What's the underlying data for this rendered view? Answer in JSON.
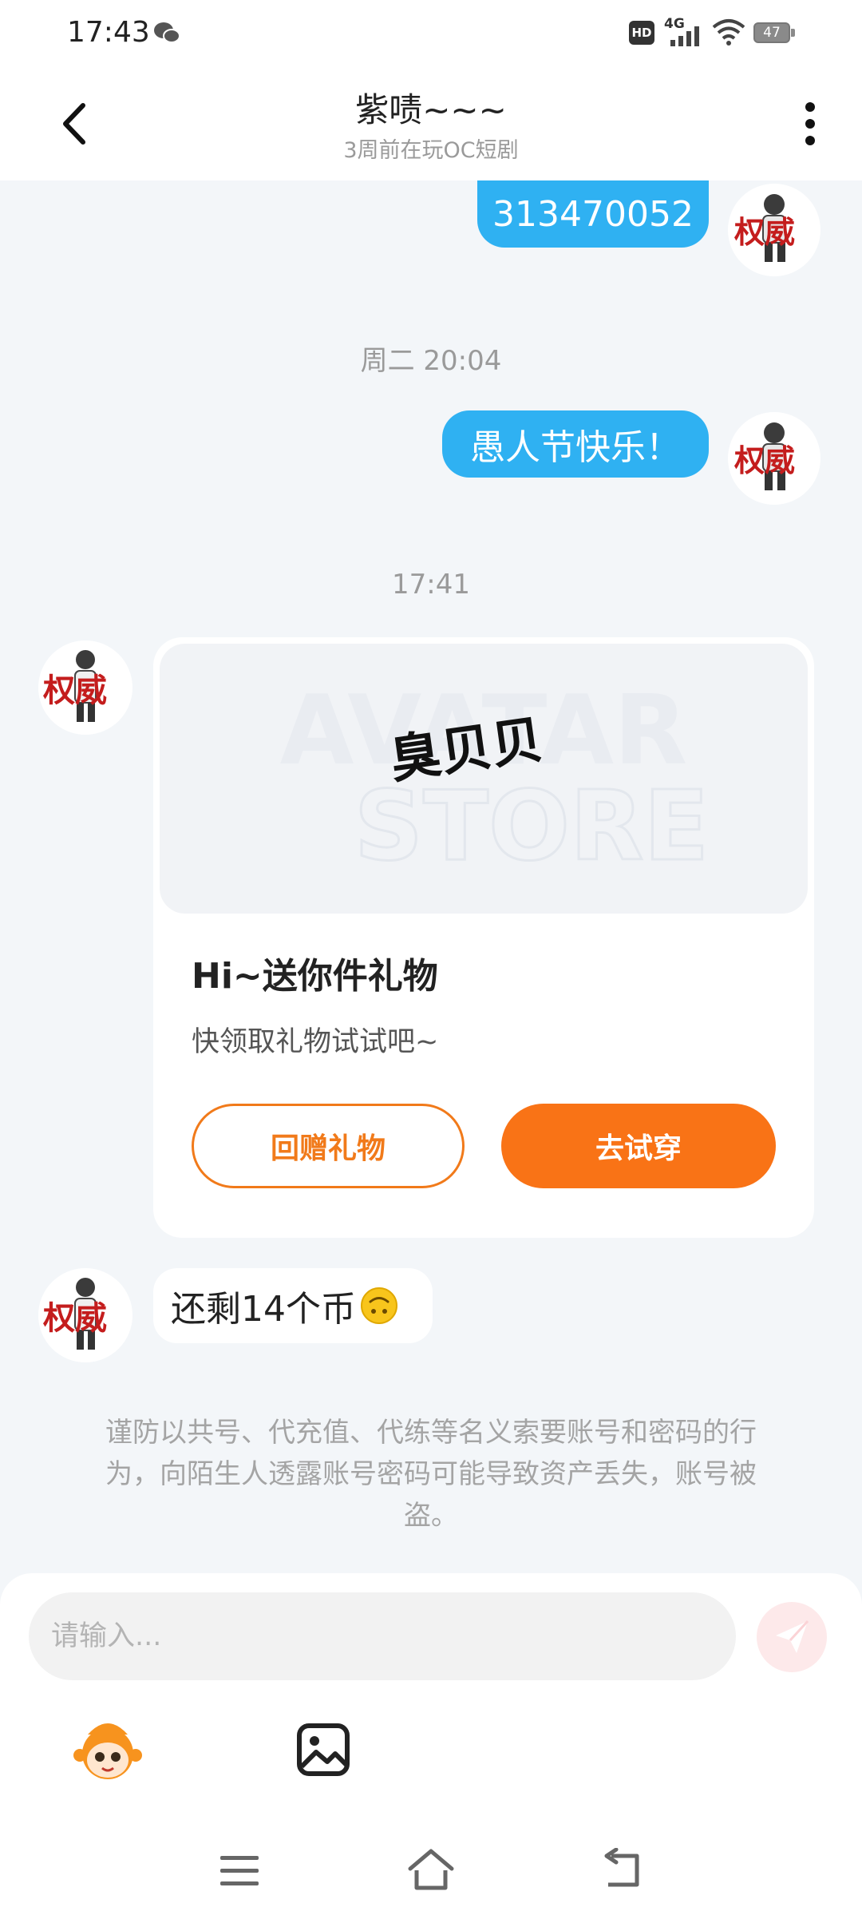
{
  "status_bar": {
    "time": "17:43",
    "hd_label": "HD",
    "network_label": "4G",
    "battery_level": "47"
  },
  "header": {
    "title": "紫啧~~~",
    "subtitle": "3周前在玩OC短剧"
  },
  "messages": {
    "outgoing_1": "313470052",
    "timestamp_1": "周二 20:04",
    "outgoing_2": "愚人节快乐！",
    "timestamp_2": "17:41",
    "incoming_text": "还剩14个币"
  },
  "gift_card": {
    "watermark_top": "AVATAR",
    "watermark_bottom": "STORE",
    "item_name": "臭贝贝",
    "title": "Hi~送你件礼物",
    "subtitle": "快领取礼物试试吧~",
    "return_gift_label": "回赠礼物",
    "try_on_label": "去试穿"
  },
  "avatar_text": {
    "big": "权威"
  },
  "warning_text": "谨防以共号、代充值、代练等名义索要账号和密码的行为，向陌生人透露账号密码可能导致资产丢失，账号被盗。",
  "composer": {
    "placeholder": "请输入..."
  },
  "colors": {
    "accent_blue": "#2fb1f2",
    "accent_orange": "#f97316",
    "background": "#f3f6f9"
  },
  "icons": [
    "wechat-icon",
    "signal-icon",
    "wifi-icon",
    "battery-icon",
    "back-arrow-icon",
    "more-vert-icon",
    "send-icon",
    "emoji-mascot-icon",
    "image-icon",
    "menu-icon",
    "home-icon",
    "back-nav-icon",
    "upside-down-face-emoji"
  ]
}
